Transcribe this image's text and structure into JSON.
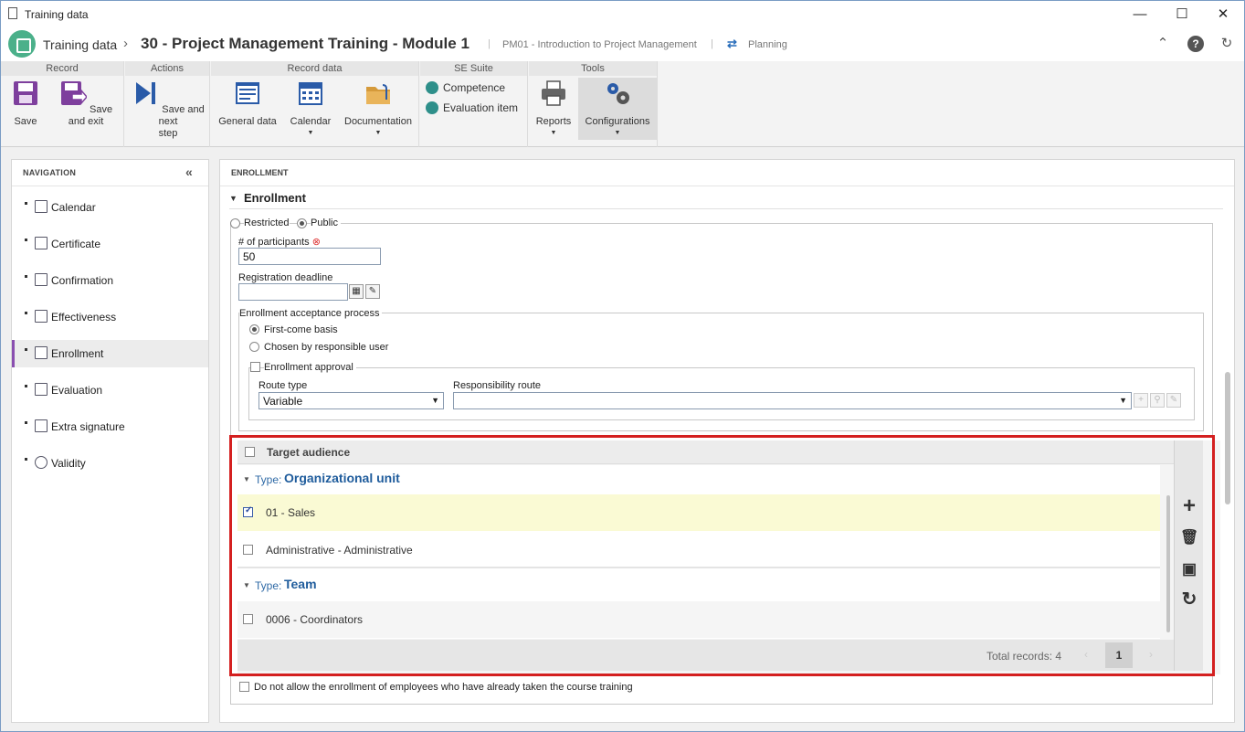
{
  "window": {
    "title": "Training data",
    "controls": {
      "minimize": "—",
      "maximize": "☐",
      "close": "✕"
    }
  },
  "header": {
    "app_name": "Training data",
    "separator": "›",
    "record_title": "30 - Project Management Training - Module 1",
    "divider": "|",
    "course": "PM01 - Introduction to Project Management",
    "phase_icon": "⇄",
    "phase": "Planning",
    "icons": {
      "collapse": "⌃",
      "help": "?",
      "refresh": "↻"
    }
  },
  "ribbon": {
    "groups": [
      {
        "label": "Record"
      },
      {
        "label": "Actions"
      },
      {
        "label": "Record data"
      },
      {
        "label": "SE Suite"
      },
      {
        "label": "Tools"
      }
    ],
    "buttons": {
      "save": "Save",
      "save_exit": "Save and exit",
      "save_next_1": "Save and next",
      "save_next_2": "step",
      "general_data": "General data",
      "calendar": "Calendar",
      "documentation": "Documentation",
      "competence": "Competence",
      "evaluation_item": "Evaluation item",
      "reports": "Reports",
      "configurations": "Configurations",
      "dropdown_arrow": "▼"
    },
    "colors": {
      "save": "#7e3f9d",
      "primary": "#2a5ba8",
      "suite": "#2e8f8a"
    }
  },
  "navigation": {
    "header": "NAVIGATION",
    "collapse_glyph": "«",
    "items": [
      {
        "label": "Calendar"
      },
      {
        "label": "Certificate"
      },
      {
        "label": "Confirmation"
      },
      {
        "label": "Effectiveness"
      },
      {
        "label": "Enrollment"
      },
      {
        "label": "Evaluation"
      },
      {
        "label": "Extra signature"
      },
      {
        "label": "Validity"
      }
    ],
    "active_color": "#8a4fb0"
  },
  "enrollment": {
    "panel_header": "ENROLLMENT",
    "section_title": "Enrollment",
    "section_toggle": "▼",
    "visibility": {
      "restricted": "Restricted",
      "public": "Public",
      "selected": "Public"
    },
    "participants": {
      "label": "# of participants",
      "required_mark": "⊗",
      "value": "50"
    },
    "registration_deadline": {
      "label": "Registration deadline",
      "value": "",
      "calendar_glyph": "▦",
      "clear_glyph": "✎"
    },
    "acceptance": {
      "label": "Enrollment acceptance process",
      "first_come": "First-come basis",
      "chosen_by_user": "Chosen by responsible user",
      "selected": "First-come basis"
    },
    "approval": {
      "label": "Enrollment approval",
      "checked": false,
      "route_type_label": "Route type",
      "route_type_value": "Variable",
      "responsibility_route_label": "Responsibility route",
      "responsibility_route_value": "",
      "select_arrow": "▼",
      "route_icons": {
        "add": "+",
        "search": "⚲",
        "clear": "✎"
      }
    },
    "target_audience": {
      "column_header": "Target audience",
      "type_label": "Type:",
      "group_toggle": "▼",
      "groups": [
        {
          "type": "Organizational unit",
          "rows": [
            {
              "label": "01 - Sales",
              "checked": true
            },
            {
              "label": "Administrative - Administrative",
              "checked": false
            }
          ]
        },
        {
          "type": "Team",
          "rows": [
            {
              "label": "0006 - Coordinators",
              "checked": false
            }
          ]
        }
      ],
      "total_records": "Total records: 4",
      "page": "1",
      "prev": "‹",
      "next": "›",
      "actions": {
        "add": "+",
        "delete": "🗑",
        "view": "▣",
        "refresh": "↻"
      }
    },
    "no_repeat_enrollment": "Do not allow the enrollment of employees who have already taken the course training"
  },
  "colors": {
    "highlight_border": "#d42020",
    "selected_row": "#fafad4",
    "group_type": "#1f5c9c"
  }
}
